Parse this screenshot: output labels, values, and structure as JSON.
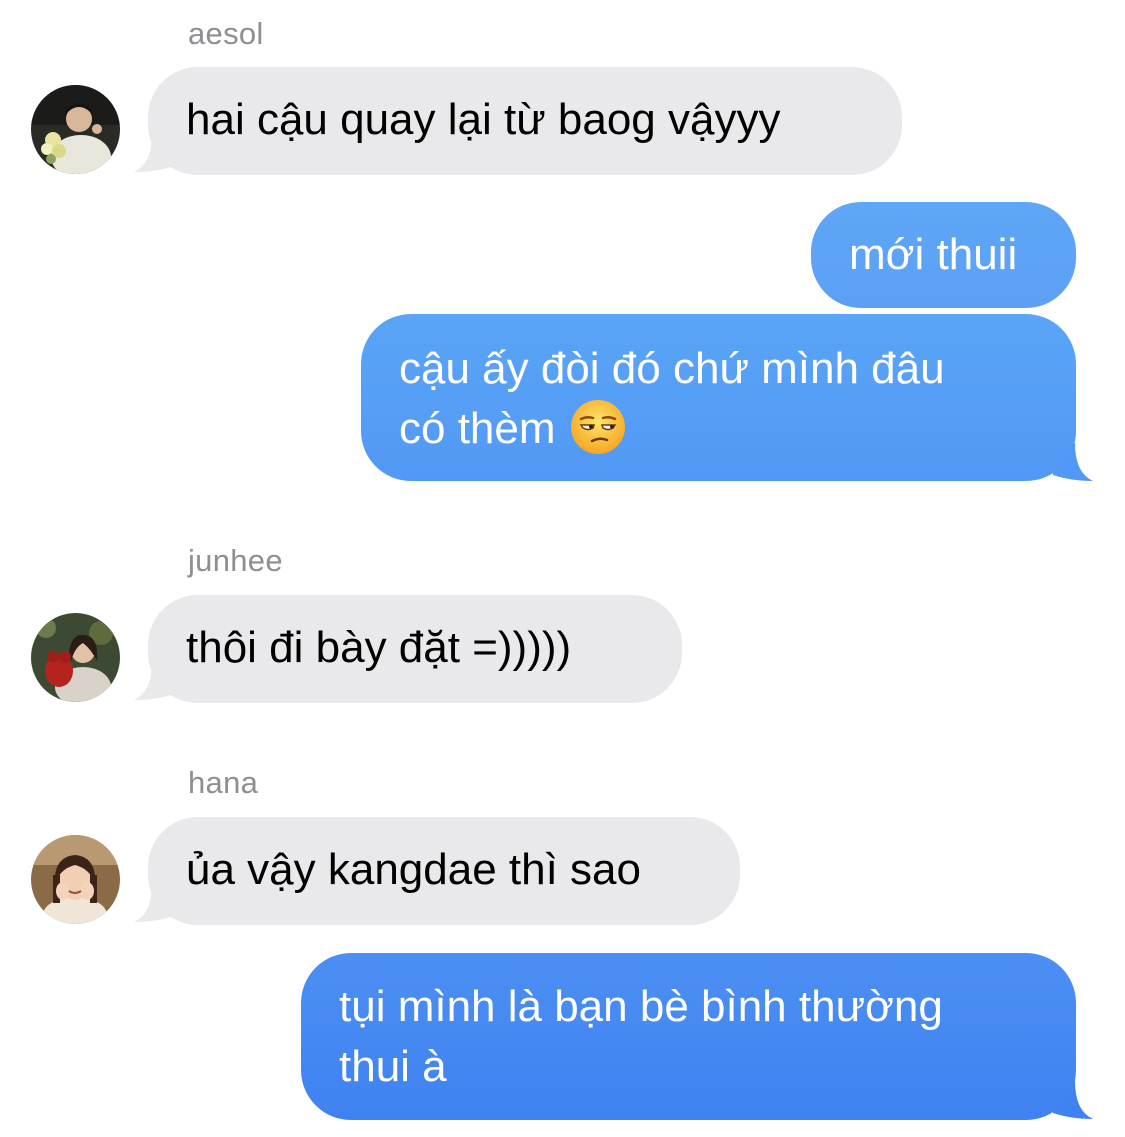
{
  "conversation": {
    "messages": [
      {
        "sender": "aesol",
        "direction": "incoming",
        "lines": [
          "hai cậu quay lại từ baog vậyyy"
        ]
      },
      {
        "direction": "outgoing",
        "lines": [
          "mới thuii"
        ]
      },
      {
        "direction": "outgoing",
        "lines": [
          "cậu ấy đòi đó chứ mình đâu",
          "có thèm"
        ],
        "emoji": "unamused-face-icon"
      },
      {
        "sender": "junhee",
        "direction": "incoming",
        "lines": [
          "thôi đi bày đặt =)))))"
        ]
      },
      {
        "sender": "hana",
        "direction": "incoming",
        "lines": [
          "ủa vậy kangdae thì sao"
        ]
      },
      {
        "direction": "outgoing",
        "lines": [
          "tụi mình là bạn bè bình thường",
          "thui à"
        ]
      }
    ]
  },
  "colors": {
    "incoming_bubble": "#e9e9eb",
    "outgoing_bubble": "#4f9bf7",
    "sender_name": "#8e8e93"
  }
}
